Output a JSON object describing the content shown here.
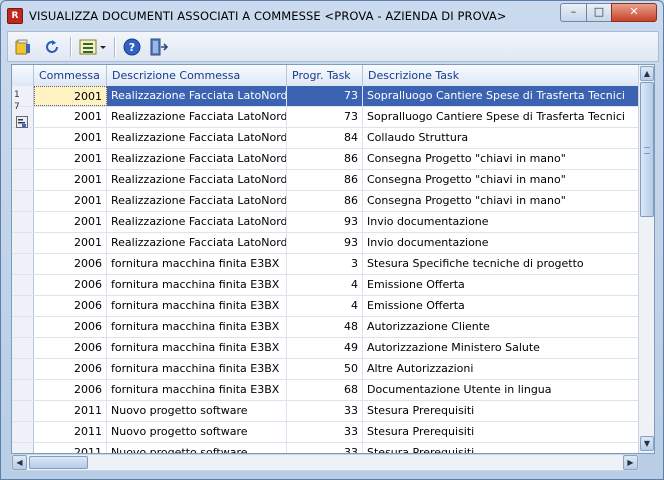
{
  "window": {
    "title": "VISUALIZZA DOCUMENTI ASSOCIATI A COMMESSE <PROVA - AZIENDA DI PROVA>",
    "app_icon": "app-red-icon",
    "controls": [
      "minimize-icon",
      "maximize-icon",
      "close-icon"
    ]
  },
  "toolbar": {
    "buttons": [
      {
        "name": "open-document-button",
        "icon": "folder-book-icon"
      },
      {
        "name": "refresh-button",
        "icon": "refresh-icon"
      },
      {
        "name": "list-view-button",
        "icon": "list-dropdown-icon"
      },
      {
        "name": "help-button",
        "icon": "help-icon"
      },
      {
        "name": "exit-button",
        "icon": "exit-door-icon"
      }
    ]
  },
  "grid": {
    "columns": [
      "Commessa",
      "Descrizione Commessa",
      "Progr. Task",
      "Descrizione Task"
    ],
    "row_indicator": [
      "1",
      "7"
    ],
    "rows": [
      {
        "commessa": "2001",
        "descrizione": "Realizzazione Facciata LatoNord",
        "progr": "73",
        "task": "Sopralluogo Cantiere Spese di Trasferta Tecnici",
        "selected": true
      },
      {
        "commessa": "2001",
        "descrizione": "Realizzazione Facciata LatoNord",
        "progr": "73",
        "task": "Sopralluogo Cantiere Spese di Trasferta Tecnici"
      },
      {
        "commessa": "2001",
        "descrizione": "Realizzazione Facciata LatoNord",
        "progr": "84",
        "task": "Collaudo Struttura"
      },
      {
        "commessa": "2001",
        "descrizione": "Realizzazione Facciata LatoNord",
        "progr": "86",
        "task": "Consegna Progetto \"chiavi in mano\""
      },
      {
        "commessa": "2001",
        "descrizione": "Realizzazione Facciata LatoNord",
        "progr": "86",
        "task": "Consegna Progetto \"chiavi in mano\""
      },
      {
        "commessa": "2001",
        "descrizione": "Realizzazione Facciata LatoNord",
        "progr": "86",
        "task": "Consegna Progetto \"chiavi in mano\""
      },
      {
        "commessa": "2001",
        "descrizione": "Realizzazione Facciata LatoNord",
        "progr": "93",
        "task": "Invio documentazione"
      },
      {
        "commessa": "2001",
        "descrizione": "Realizzazione Facciata LatoNord",
        "progr": "93",
        "task": "Invio documentazione"
      },
      {
        "commessa": "2006",
        "descrizione": "fornitura macchina  finita E3BX",
        "progr": "3",
        "task": "Stesura Specifiche tecniche di progetto"
      },
      {
        "commessa": "2006",
        "descrizione": "fornitura macchina  finita E3BX",
        "progr": "4",
        "task": "Emissione Offerta"
      },
      {
        "commessa": "2006",
        "descrizione": "fornitura macchina  finita E3BX",
        "progr": "4",
        "task": "Emissione Offerta"
      },
      {
        "commessa": "2006",
        "descrizione": "fornitura macchina  finita E3BX",
        "progr": "48",
        "task": "Autorizzazione Cliente"
      },
      {
        "commessa": "2006",
        "descrizione": "fornitura macchina  finita E3BX",
        "progr": "49",
        "task": "Autorizzazione Ministero Salute"
      },
      {
        "commessa": "2006",
        "descrizione": "fornitura macchina  finita E3BX",
        "progr": "50",
        "task": "Altre Autorizzazioni"
      },
      {
        "commessa": "2006",
        "descrizione": "fornitura macchina  finita E3BX",
        "progr": "68",
        "task": "Documentazione Utente in lingua"
      },
      {
        "commessa": "2011",
        "descrizione": "Nuovo progetto software",
        "progr": "33",
        "task": "Stesura Prerequisiti"
      },
      {
        "commessa": "2011",
        "descrizione": "Nuovo progetto software",
        "progr": "33",
        "task": "Stesura Prerequisiti"
      },
      {
        "commessa": "2011",
        "descrizione": "Nuovo progetto software",
        "progr": "33",
        "task": "Stesura Prerequisiti"
      },
      {
        "commessa": "2011",
        "descrizione": "Nuovo progetto software",
        "progr": "33",
        "task": "Stesura Prerequisiti"
      }
    ]
  },
  "colors": {
    "selection": "#3b63b2",
    "header_text": "#1a3a8a",
    "active_cell": "#fff3c4"
  }
}
